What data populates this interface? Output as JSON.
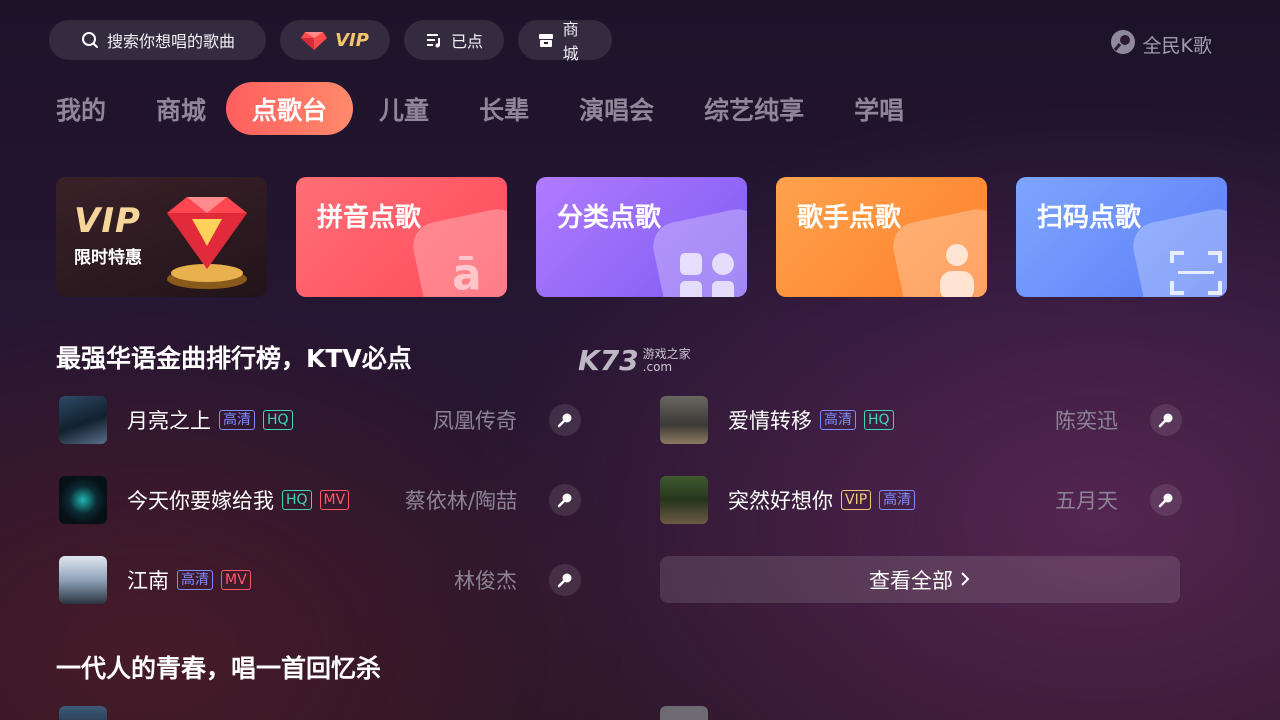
{
  "topbar": {
    "search_placeholder": "搜索你想唱的歌曲",
    "vip_label": "VIP",
    "queued_label": "已点",
    "mall_label": "商城"
  },
  "brand": {
    "name": "全民K歌"
  },
  "tabs": [
    {
      "label": "我的"
    },
    {
      "label": "商城"
    },
    {
      "label": "点歌台",
      "active": true
    },
    {
      "label": "儿童"
    },
    {
      "label": "长辈"
    },
    {
      "label": "演唱会"
    },
    {
      "label": "综艺纯享"
    },
    {
      "label": "学唱"
    }
  ],
  "cards": {
    "vip": {
      "big": "VIP",
      "sub": "限时特惠"
    },
    "pinyin": "拼音点歌",
    "category": "分类点歌",
    "singer": "歌手点歌",
    "scan": "扫码点歌"
  },
  "watermark": {
    "logo": "K73",
    "line1": "游戏之家",
    "line2": ".com"
  },
  "section1": {
    "title": "最强华语金曲排行榜，KTV必点",
    "songs": [
      {
        "name": "月亮之上",
        "tags": [
          "高清",
          "HQ"
        ],
        "singer": "凤凰传奇"
      },
      {
        "name": "爱情转移",
        "tags": [
          "高清",
          "HQ"
        ],
        "singer": "陈奕迅"
      },
      {
        "name": "今天你要嫁给我",
        "tags": [
          "HQ",
          "MV"
        ],
        "singer": "蔡依林/陶喆"
      },
      {
        "name": "突然好想你",
        "tags": [
          "VIP",
          "高清"
        ],
        "singer": "五月天"
      },
      {
        "name": "江南",
        "tags": [
          "高清",
          "MV"
        ],
        "singer": "林俊杰"
      }
    ],
    "view_all": "查看全部"
  },
  "section2": {
    "title": "一代人的青春，唱一首回忆杀"
  },
  "colors": {
    "accent_start": "#ff5e5e",
    "accent_end": "#ff8a6c",
    "tag_hd": "#7e8cff",
    "tag_hq": "#3fd6b5",
    "tag_mv": "#ff5a6a",
    "tag_vip": "#f2c77d"
  }
}
